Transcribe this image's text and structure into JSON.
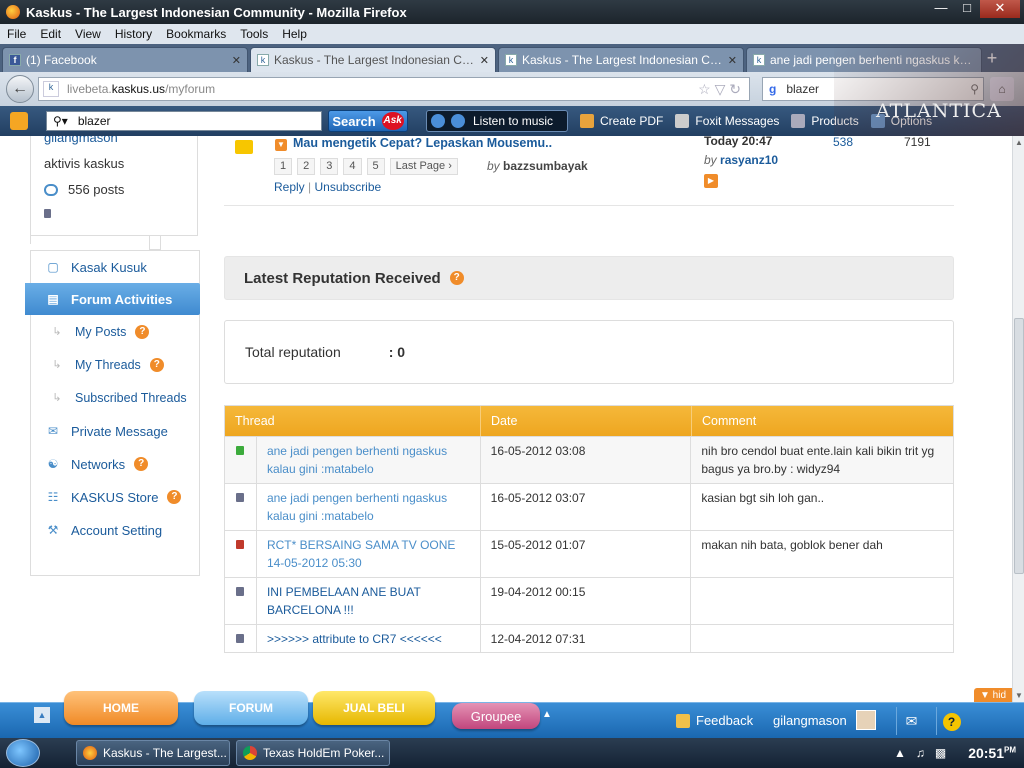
{
  "window": {
    "title": "Kaskus - The Largest Indonesian Community - Mozilla Firefox"
  },
  "menubar": [
    "File",
    "Edit",
    "View",
    "History",
    "Bookmarks",
    "Tools",
    "Help"
  ],
  "tabs": [
    {
      "label": "(1) Facebook",
      "icon": "facebook-icon"
    },
    {
      "label": "Kaskus - The Largest Indonesian Com...",
      "icon": "kaskus-icon",
      "active": true
    },
    {
      "label": "Kaskus - The Largest Indonesian Com...",
      "icon": "kaskus-icon"
    },
    {
      "label": "ane jadi pengen berhenti ngaskus kal...",
      "icon": "kaskus-icon"
    }
  ],
  "url": {
    "prefix": "livebeta.",
    "domain": "kaskus.us",
    "path": "/myforum"
  },
  "google_search": {
    "engine": "g",
    "value": "blazer"
  },
  "ask_toolbar": {
    "search_value": "blazer",
    "search_label": "Search",
    "ask_label": "Ask",
    "music_label": "Listen to music",
    "create_pdf": "Create PDF",
    "foxit": "Foxit Messages",
    "products": "Products",
    "options": "Options"
  },
  "brand_overlay": "ATLANTICA",
  "profile": {
    "username": "gilangmason",
    "title": "aktivis kaskus",
    "posts": "556 posts"
  },
  "sidebar": [
    {
      "label": "Kasak Kusuk",
      "icon": "chat-icon"
    },
    {
      "label": "Forum Activities",
      "icon": "forum-icon",
      "active": true
    },
    {
      "label": "My Posts",
      "icon": "sub-arrow-icon",
      "sub": true,
      "help": true
    },
    {
      "label": "My Threads",
      "icon": "sub-arrow-icon",
      "sub": true,
      "help": true
    },
    {
      "label": "Subscribed Threads",
      "icon": "sub-arrow-icon",
      "sub": true
    },
    {
      "label": "Private Message",
      "icon": "envelope-icon"
    },
    {
      "label": "Networks",
      "icon": "network-icon",
      "help": true
    },
    {
      "label": "KASKUS Store",
      "icon": "cart-icon",
      "help": true
    },
    {
      "label": "Account Setting",
      "icon": "wrench-icon"
    }
  ],
  "thread": {
    "title": "Mau mengetik Cepat? Lepaskan Mousemu..",
    "pages": [
      "1",
      "2",
      "3",
      "4",
      "5",
      "Last Page ›"
    ],
    "by_prefix": "by",
    "author": "bazzsumbayak",
    "reply": "Reply",
    "separator": "|",
    "unsubscribe": "Unsubscribe",
    "last_post": "Today 20:47",
    "last_by_prefix": "by",
    "last_by": "rasyanz10",
    "replies": "538",
    "views": "7191"
  },
  "reputation": {
    "heading": "Latest Reputation Received",
    "help": "?",
    "total_label": "Total reputation",
    "total_value": ": 0",
    "columns": [
      "Thread",
      "Date",
      "Comment"
    ],
    "rows": [
      {
        "color": "#3cab3c",
        "thread": "ane jadi pengen berhenti ngaskus kalau gini :matabelo",
        "date": "16-05-2012 03:08",
        "comment": "nih bro cendol buat ente.lain kali bikin trit yg bagus ya bro.by : widyz94"
      },
      {
        "color": "#6a6f8a",
        "thread": "ane jadi pengen berhenti ngaskus kalau gini :matabelo",
        "date": "16-05-2012 03:07",
        "comment": "kasian bgt sih loh gan.."
      },
      {
        "color": "#c0392b",
        "thread": "RCT* BERSAING SAMA TV OONE 14-05-2012 05:30",
        "date": "15-05-2012 01:07",
        "comment": "makan nih bata, goblok bener dah"
      },
      {
        "color": "#6a6f8a",
        "thread": "INI PEMBELAAN ANE BUAT BARCELONA !!!",
        "date": "19-04-2012 00:15",
        "comment": ""
      },
      {
        "color": "#6a6f8a",
        "thread": ">>>>>> attribute to CR7 <<<<<<",
        "date": "12-04-2012 07:31",
        "comment": ""
      }
    ]
  },
  "bottombar": {
    "home": "HOME",
    "forum": "FORUM",
    "jual": "JUAL BELI",
    "groupee": "Groupee",
    "feedback": "Feedback",
    "user": "gilangmason",
    "hide": "▼ hid"
  },
  "taskbar": {
    "items": [
      {
        "label": "Kaskus - The Largest...",
        "icon": "firefox-icon"
      },
      {
        "label": "Texas HoldEm Poker...",
        "icon": "chrome-icon"
      }
    ],
    "time": "20:51",
    "ampm": "PM"
  },
  "colors": {
    "accent": "#f0a82a",
    "link": "#1b5b9b",
    "active_menu": "#4a95d8"
  }
}
